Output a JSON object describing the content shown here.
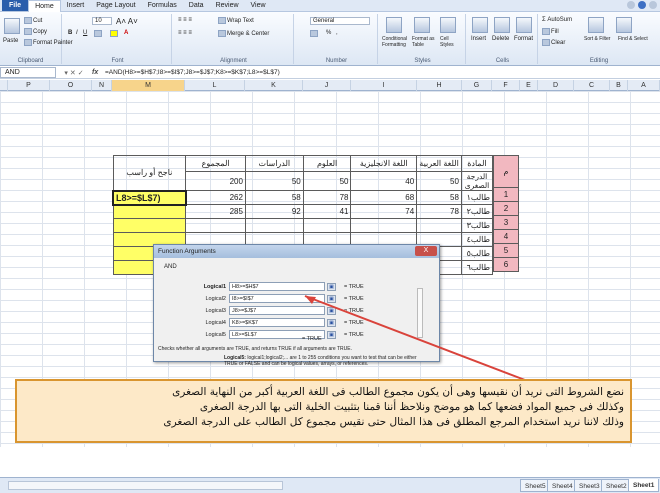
{
  "menu": {
    "file": "File",
    "tabs": [
      "Home",
      "Insert",
      "Page Layout",
      "Formulas",
      "Data",
      "Review",
      "View"
    ],
    "active": "Home"
  },
  "ribbon": {
    "clipboard": {
      "label": "Clipboard",
      "paste": "Paste",
      "cut": "Cut",
      "copy": "Copy",
      "format_painter": "Format Painter"
    },
    "font": {
      "label": "Font",
      "size": "10",
      "bold": "B",
      "italic": "I",
      "underline": "U"
    },
    "alignment": {
      "label": "Alignment",
      "wrap": "Wrap Text",
      "merge": "Merge & Center"
    },
    "number": {
      "label": "Number",
      "format": "General",
      "percent": "%",
      "comma": ","
    },
    "styles": {
      "label": "Styles",
      "conditional": "Conditional Formatting",
      "format_table": "Format as Table",
      "cell_styles": "Cell Styles"
    },
    "cells": {
      "label": "Cells",
      "insert": "Insert",
      "delete": "Delete",
      "format": "Format"
    },
    "editing": {
      "label": "Editing",
      "autosum": "AutoSum",
      "fill": "Fill",
      "clear": "Clear",
      "sort": "Sort & Filter",
      "find": "Find & Select"
    }
  },
  "formula_bar": {
    "name_box": "AND",
    "formula": "=AND(H8>=$H$7;I8>=$I$7;J8>=$J$7;K8>=$K$7;L8>=$L$7)"
  },
  "columns": [
    "P",
    "O",
    "N",
    "M",
    "L",
    "K",
    "J",
    "I",
    "H",
    "G",
    "F",
    "E",
    "D",
    "C",
    "B",
    "A"
  ],
  "selected_column": "M",
  "table": {
    "headers": {
      "result": "ناجح أو راسب",
      "total": "المجموع",
      "social": "الدراسات",
      "science": "العلوم",
      "english": "اللغة الانجليزية",
      "arabic": "اللغة العربية",
      "subject": "المادة",
      "num": "م"
    },
    "min_label": "الدرجة الصغرى",
    "min_values": [
      "200",
      "50",
      "50",
      "40",
      "50"
    ],
    "active_cell": "L8>=$L$7)",
    "rows": [
      {
        "name": "طالب١",
        "n": "1",
        "vals": [
          "262",
          "58",
          "78",
          "68",
          "58"
        ]
      },
      {
        "name": "طالب٢",
        "n": "2",
        "vals": [
          "285",
          "92",
          "41",
          "74",
          "78"
        ]
      },
      {
        "name": "طالب٣",
        "n": "3",
        "vals": [
          "",
          "",
          "",
          "",
          ""
        ]
      },
      {
        "name": "طالب٤",
        "n": "4",
        "vals": [
          "",
          "",
          "",
          "",
          ""
        ]
      },
      {
        "name": "طالب٥",
        "n": "5",
        "vals": [
          "",
          "",
          "",
          "",
          ""
        ]
      },
      {
        "name": "طالب٦",
        "n": "6",
        "vals": [
          "",
          "",
          "",
          "",
          ""
        ]
      }
    ]
  },
  "dialog": {
    "title": "Function Arguments",
    "close": "X",
    "function": "AND",
    "args": [
      {
        "label": "Logical1",
        "value": "H8>=$H$7",
        "result": "= TRUE"
      },
      {
        "label": "Logical2",
        "value": "I8>=$I$7",
        "result": "= TRUE"
      },
      {
        "label": "Logical3",
        "value": "J8>=$J$7",
        "result": "= TRUE"
      },
      {
        "label": "Logical4",
        "value": "K8>=$K$7",
        "result": "= TRUE"
      },
      {
        "label": "Logical5",
        "value": "L8>=$L$7",
        "result": "= TRUE"
      }
    ],
    "total": "= TRUE",
    "description": "Checks whether all arguments are TRUE, and returns TRUE if all arguments are TRUE.",
    "help_label": "Logical5:",
    "help_text": "logical1;logical2;... are 1 to 255 conditions you want to test that can be either TRUE or FALSE and can be logical values, arrays, or references."
  },
  "note": {
    "line1": "نضع الشروط التى نريد أن نقيسها وهى أن يكون مجموع الطالب فى اللغة العربية أكبر من النهاية الصغرى",
    "line2": "وكذلك فى جميع المواد فضعها كما هو موضح ونلاحظ أننا قمنا بتثبيت الخلية التى بها الدرجة الصغرى",
    "line3": "وذلك لاننا نريد استخدام المرجع المطلق فى هذا المثال حتى نقيس مجموع كل الطالب على الدرجة الصغرى"
  },
  "sheets": [
    "Sheet5",
    "Sheet4",
    "Sheet3",
    "Sheet2",
    "Sheet1"
  ],
  "active_sheet": "Sheet1",
  "colors": {
    "accent": "#2a5eab",
    "note_bg": "#fde9c8",
    "note_border": "#d9952f",
    "highlight": "#ffff66",
    "row_header": "#f2b8c0",
    "arrow": "#d9433b"
  }
}
